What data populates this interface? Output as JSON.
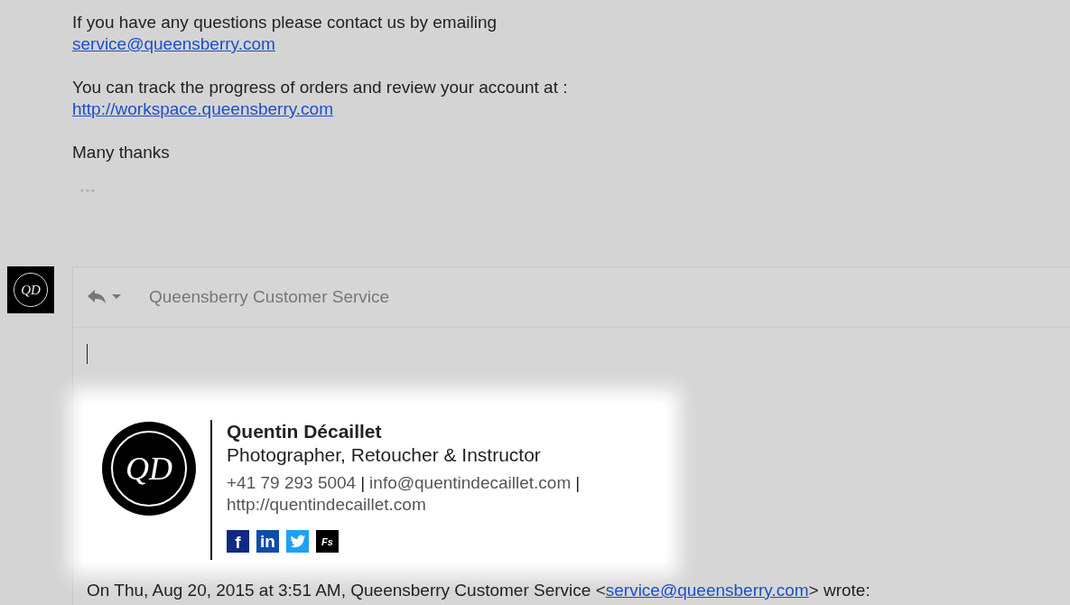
{
  "message": {
    "paragraphs": [
      {
        "text": "If you have any questions please contact us by emailing",
        "link": "service@queensberry.com"
      },
      {
        "text": "You can track the progress of orders and review your account at :",
        "link": "http://workspace.queensberry.com"
      },
      {
        "text": "Many thanks"
      }
    ],
    "trimmed_content": true
  },
  "reply": {
    "avatar_monogram": "QD",
    "recipient": "Queensberry Customer Service",
    "signature": {
      "monogram": "QD",
      "name": "Quentin Décaillet",
      "title": "Photographer, Retoucher & Instructor",
      "phone": "+41 79 293 5004",
      "separator": "|",
      "email": "info@quentindecaillet.com",
      "website": "http://quentindecaillet.com",
      "social": [
        {
          "kind": "facebook",
          "glyph": "f"
        },
        {
          "kind": "linkedin",
          "glyph": "in"
        },
        {
          "kind": "twitter"
        },
        {
          "kind": "fstoppers",
          "glyph": "Fs"
        }
      ]
    },
    "quote": {
      "text": "On Thu, Aug 20, 2015 at 3:51 AM, Queensberry Customer Service <",
      "link": "service@queensberry.com",
      "after": "> wrote:"
    }
  }
}
